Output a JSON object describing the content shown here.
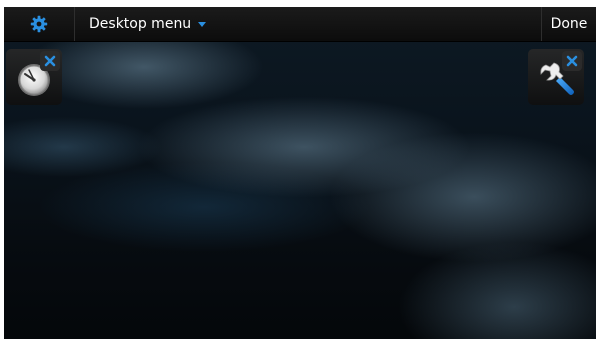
{
  "topbar": {
    "settings_icon": "gear-icon",
    "menu_title": "Desktop menu",
    "menu_arrow_icon": "dropdown-triangle-icon",
    "done_label": "Done"
  },
  "widgets": [
    {
      "name": "clock",
      "icon": "clock-icon",
      "close_icon": "close-x-icon"
    },
    {
      "name": "settings",
      "icon": "wrench-icon",
      "close_icon": "close-x-icon"
    }
  ],
  "colors": {
    "accent": "#2a8fe0",
    "topbar_bg": "#141414",
    "text": "#ffffff"
  }
}
